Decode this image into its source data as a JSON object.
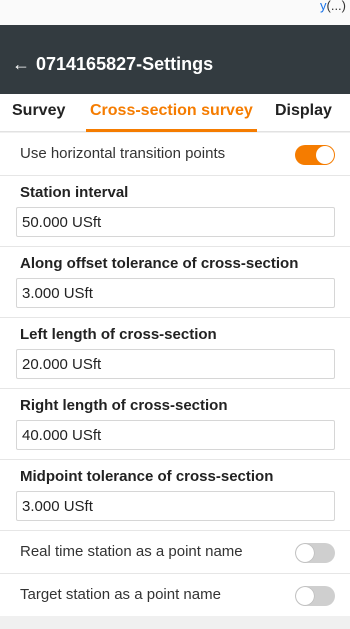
{
  "status_bar": {
    "clipped_text": "y",
    "clipped_paren": "(...)"
  },
  "app_bar": {
    "back_glyph": "←",
    "title": "0714165827-Settings"
  },
  "tabs": [
    {
      "label": "Survey",
      "selected": false
    },
    {
      "label": "Cross-section survey",
      "selected": true
    },
    {
      "label": "Display",
      "selected": false
    }
  ],
  "settings": {
    "horizontal_transition": {
      "label": "Use horizontal transition points",
      "enabled": true
    },
    "fields": [
      {
        "label": "Station interval",
        "value": "50.000 USft"
      },
      {
        "label": "Along offset tolerance of cross-section",
        "value": "3.000 USft"
      },
      {
        "label": "Left length of cross-section",
        "value": "20.000 USft"
      },
      {
        "label": "Right length of cross-section",
        "value": "40.000 USft"
      },
      {
        "label": "Midpoint tolerance of cross-section",
        "value": "3.000 USft"
      }
    ],
    "realtime_station": {
      "label": "Real time station as a point name",
      "enabled": false
    },
    "target_station": {
      "label": "Target station as a point name",
      "enabled": false
    }
  },
  "colors": {
    "accent": "#f57c00",
    "app_bar": "#333b40",
    "switch_off": "#cfcfcf"
  },
  "icons": {
    "back": "back-arrow-icon"
  }
}
